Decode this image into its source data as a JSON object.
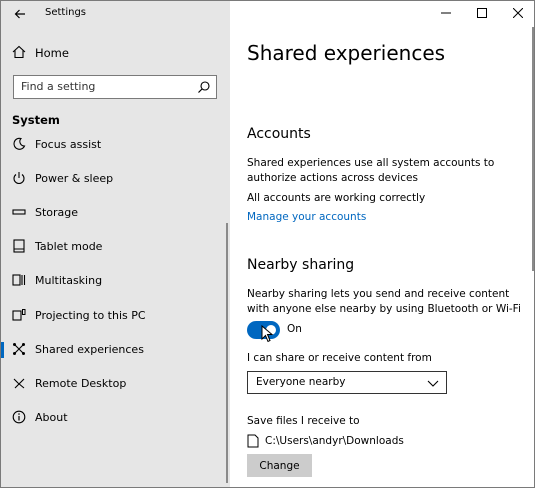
{
  "window": {
    "title": "Settings"
  },
  "sidebar": {
    "home_label": "Home",
    "search_placeholder": "Find a setting",
    "group_label": "System",
    "items": [
      {
        "label": "Focus assist",
        "icon": "moon-icon"
      },
      {
        "label": "Power & sleep",
        "icon": "power-icon"
      },
      {
        "label": "Storage",
        "icon": "storage-icon"
      },
      {
        "label": "Tablet mode",
        "icon": "tablet-icon"
      },
      {
        "label": "Multitasking",
        "icon": "multitasking-icon"
      },
      {
        "label": "Projecting to this PC",
        "icon": "projecting-icon"
      },
      {
        "label": "Shared experiences",
        "icon": "shared-experiences-icon",
        "selected": true
      },
      {
        "label": "Remote Desktop",
        "icon": "remote-desktop-icon"
      },
      {
        "label": "About",
        "icon": "info-icon"
      }
    ]
  },
  "main": {
    "title": "Shared experiences",
    "accounts": {
      "heading": "Accounts",
      "description": "Shared experiences use all system accounts to authorize actions across devices",
      "status": "All accounts are working correctly",
      "manage_link": "Manage your accounts"
    },
    "nearby": {
      "heading": "Nearby sharing",
      "description": "Nearby sharing lets you send and receive content with anyone else nearby by using Bluetooth or Wi-Fi",
      "toggle_state": "On",
      "share_label": "I can share or receive content from",
      "share_value": "Everyone nearby",
      "save_label": "Save files I receive to",
      "save_path": "C:\\Users\\andyr\\Downloads",
      "change_button": "Change"
    }
  },
  "colors": {
    "accent": "#0067c0",
    "sidebar_bg": "#e6e6e6"
  }
}
